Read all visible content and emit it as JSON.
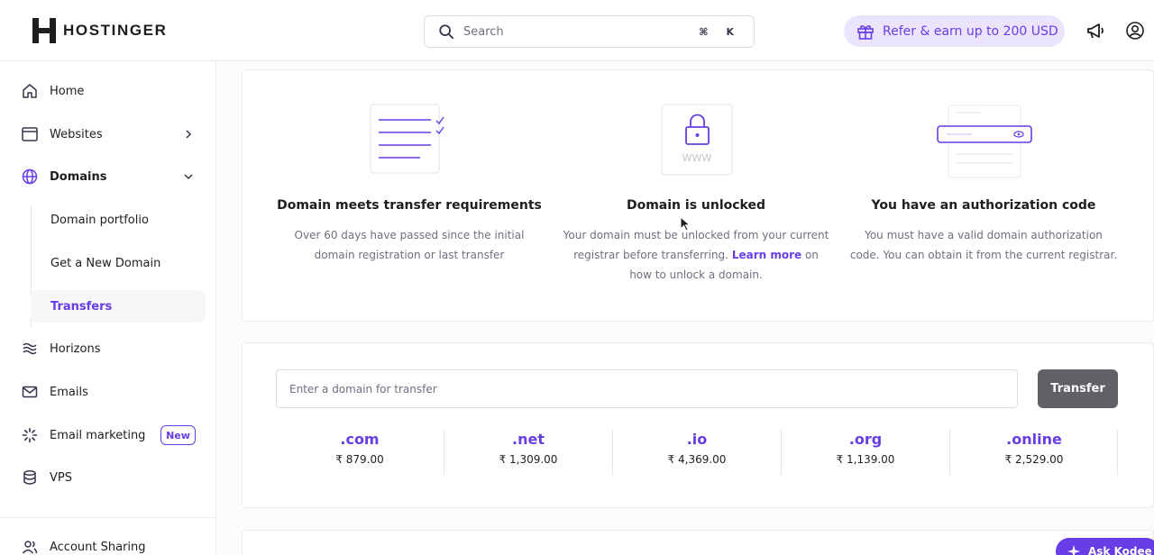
{
  "header": {
    "logo_text": "HOSTINGER",
    "search_placeholder": "Search",
    "shortcut_key1": "⌘",
    "shortcut_key2": "K",
    "refer_label": "Refer & earn up to 200 USD",
    "icons": [
      "search-icon",
      "gift-icon",
      "megaphone-icon",
      "account-icon"
    ]
  },
  "sidebar": {
    "items": [
      {
        "label": "Home",
        "icon": "home-icon"
      },
      {
        "label": "Websites",
        "icon": "browser-icon"
      },
      {
        "label": "Domains",
        "icon": "globe-icon"
      },
      {
        "label": "Horizons",
        "icon": "waves-icon"
      },
      {
        "label": "Emails",
        "icon": "mail-icon"
      },
      {
        "label": "Email marketing",
        "icon": "spark-icon",
        "badge": "New"
      },
      {
        "label": "VPS",
        "icon": "database-icon"
      },
      {
        "label": "Account Sharing",
        "icon": "users-icon"
      }
    ],
    "domains_sub": [
      {
        "label": "Domain portfolio"
      },
      {
        "label": "Get a New Domain"
      },
      {
        "label": "Transfers",
        "active": true
      }
    ],
    "accent_color": "#673de6"
  },
  "requirements": [
    {
      "title": "Domain meets transfer requirements",
      "text": "Over 60 days have passed since the initial domain registration or last transfer",
      "icon": "checklist-illustration"
    },
    {
      "title": "Domain is unlocked",
      "text_before": "Your domain must be unlocked from your current registrar before transferring.",
      "link": "Learn more",
      "text_after": "on how to unlock a domain.",
      "illus_text": "WWW",
      "icon": "padlock-illustration"
    },
    {
      "title": "You have an authorization code",
      "text": "You must have a valid domain authorization code. You can obtain it from the current registrar.",
      "icon": "password-field-illustration"
    }
  ],
  "transfer": {
    "input_placeholder": "Enter a domain for transfer",
    "button_label": "Transfer",
    "tlds": [
      {
        "ext": ".com",
        "price": "₹ 879.00"
      },
      {
        "ext": ".net",
        "price": "₹ 1,309.00"
      },
      {
        "ext": ".io",
        "price": "₹ 4,369.00"
      },
      {
        "ext": ".org",
        "price": "₹ 1,139.00"
      },
      {
        "ext": ".online",
        "price": "₹ 2,529.00"
      }
    ]
  },
  "assistant": {
    "label": "Ask Kodee"
  }
}
